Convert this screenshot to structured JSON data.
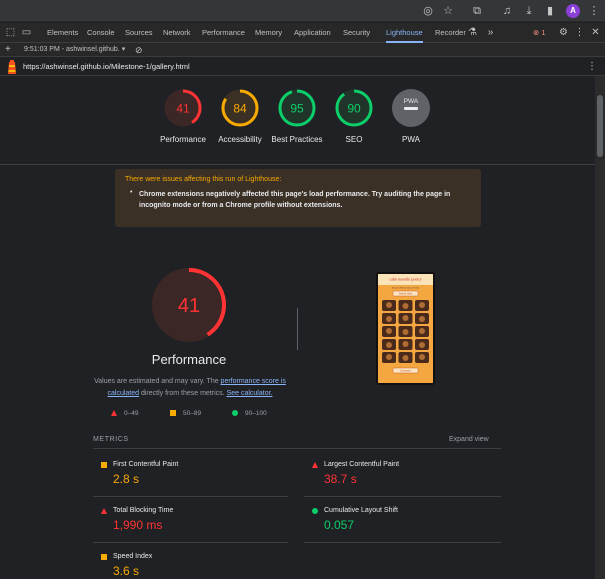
{
  "colors": {
    "fail": "#ff3333",
    "average": "#f9ab00",
    "pass": "#0cce6b",
    "link": "#8ab4f8",
    "pwa": "#5f6368"
  },
  "browser": {
    "avatar_letter": "A"
  },
  "devtools": {
    "tabs": [
      "Elements",
      "Console",
      "Sources",
      "Network",
      "Performance",
      "Memory",
      "Application",
      "Security",
      "Lighthouse",
      "Recorder"
    ],
    "active_tab": "Lighthouse",
    "error_count": "1",
    "overflow": "»"
  },
  "toolbar": {
    "run_label": "9:51:03 PM - ashwinsel.github.",
    "add": "+"
  },
  "url": "https://ashwinsel.github.io/Milestone-1/gallery.html",
  "gauges": [
    {
      "label": "Performance",
      "score": "41",
      "value": 41,
      "status": "fail"
    },
    {
      "label": "Accessibility",
      "score": "84",
      "value": 84,
      "status": "average"
    },
    {
      "label": "Best Practices",
      "score": "95",
      "value": 95,
      "status": "pass"
    },
    {
      "label": "SEO",
      "score": "90",
      "value": 90,
      "status": "pass"
    },
    {
      "label": "PWA",
      "score": "PWA",
      "value": 0,
      "status": "pwa"
    }
  ],
  "warning": {
    "title": "There were issues affecting this run of Lighthouse:",
    "bullet": "•",
    "text": "Chrome extensions negatively affected this page's load performance. Try auditing the page in incognito mode or from a Chrome profile without extensions."
  },
  "performance": {
    "score": "41",
    "value": 41,
    "title": "Performance",
    "desc_before": "Values are estimated and may vary. The ",
    "desc_link1": "performance score is calculated",
    "desc_middle": " directly from these metrics. ",
    "desc_link2": "See calculator."
  },
  "legend": {
    "fail": "0–49",
    "average": "50–89",
    "pass": "90–100"
  },
  "screenshot": {
    "site_title": "calm marathi poetry",
    "subtitle": "Marathi | Hindi | Indian | Poetry",
    "button": "Submit Here",
    "footer_button": "Comment"
  },
  "metrics": {
    "label": "METRICS",
    "expand_label": "Expand view",
    "items": [
      {
        "name": "First Contentful Paint",
        "value": "2.8 s",
        "status": "average"
      },
      {
        "name": "Largest Contentful Paint",
        "value": "38.7 s",
        "status": "fail"
      },
      {
        "name": "Total Blocking Time",
        "value": "1,990 ms",
        "status": "fail"
      },
      {
        "name": "Cumulative Layout Shift",
        "value": "0.057",
        "status": "pass"
      },
      {
        "name": "Speed Index",
        "value": "3.6 s",
        "status": "average"
      }
    ]
  }
}
